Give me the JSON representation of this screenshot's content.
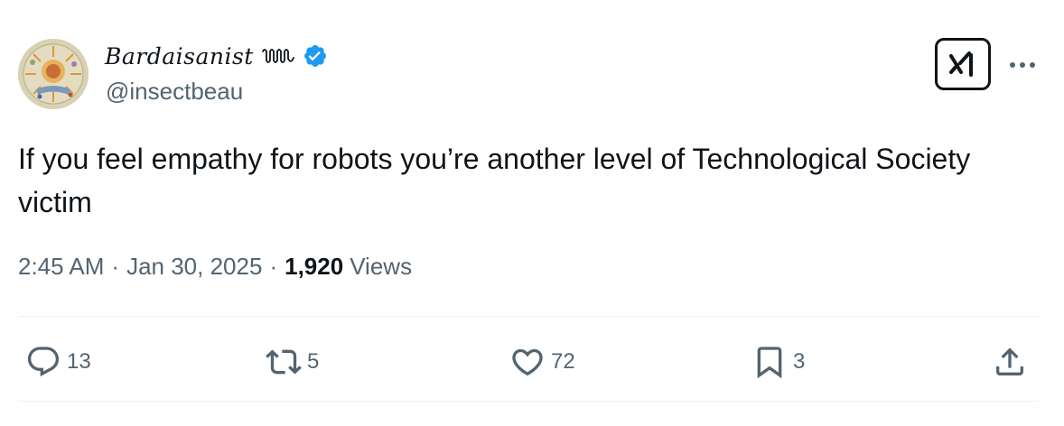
{
  "author": {
    "display_name": "Bardaisanist",
    "handle": "@insectbeau",
    "avatar_icon": "sun-medallion-avatar",
    "verified_icon": "verified-badge-icon",
    "verified_color": "#1d9bf0"
  },
  "tweet": {
    "text": "If you feel empathy for robots you’re another level of Technological Society victim",
    "time": "2:45 AM",
    "separator": "·",
    "date": "Jan 30, 2025",
    "views_count": "1,920",
    "views_label": "Views"
  },
  "header_actions": {
    "grok_icon": "grok-icon",
    "more_icon": "more-options-icon"
  },
  "actions": {
    "replies": "13",
    "reposts": "5",
    "likes": "72",
    "bookmarks": "3"
  },
  "colors": {
    "text_primary": "#0f1419",
    "text_secondary": "#536471",
    "divider": "#eff3f4"
  }
}
